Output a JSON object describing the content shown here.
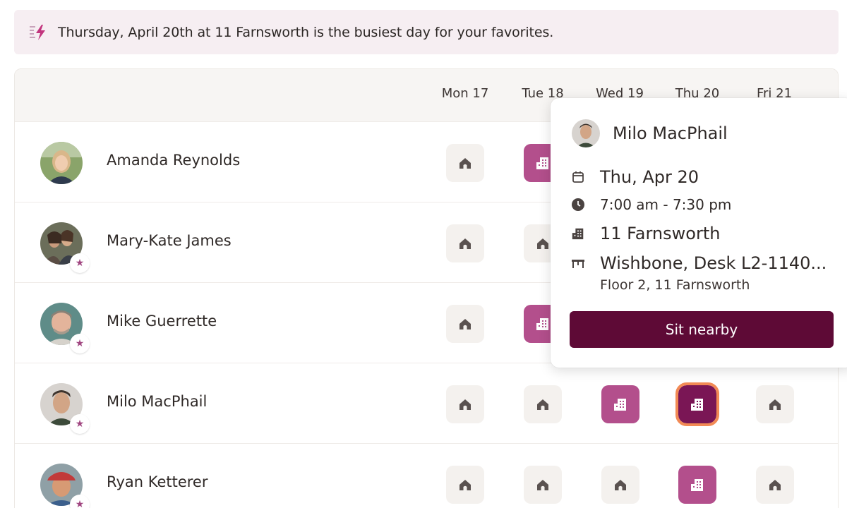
{
  "banner": {
    "icon": "bolt-icon",
    "text": "Thursday, April 20th at 11 Farnsworth is the busiest day for your favorites."
  },
  "days": [
    "Mon 17",
    "Tue 18",
    "Wed 19",
    "Thu 20",
    "Fri 21"
  ],
  "rows": [
    {
      "name": "Amanda Reynolds",
      "favorite": false,
      "cells": [
        "home",
        "office",
        "",
        "",
        ""
      ]
    },
    {
      "name": "Mary-Kate James",
      "favorite": true,
      "cells": [
        "home",
        "home",
        "",
        "",
        ""
      ]
    },
    {
      "name": "Mike Guerrette",
      "favorite": true,
      "cells": [
        "home",
        "office",
        "",
        "",
        ""
      ]
    },
    {
      "name": "Milo MacPhail",
      "favorite": true,
      "cells": [
        "home",
        "home",
        "office",
        "office-selected",
        "home"
      ]
    },
    {
      "name": "Ryan Ketterer",
      "favorite": true,
      "cells": [
        "home",
        "home",
        "home",
        "office",
        "home"
      ]
    }
  ],
  "popover": {
    "name": "Milo MacPhail",
    "date": "Thu, Apr 20",
    "time": "7:00 am - 7:30 pm",
    "building": "11 Farnsworth",
    "desk": "Wishbone, Desk L2-1140...",
    "floor": "Floor 2, 11 Farnsworth",
    "button_label": "Sit nearby"
  },
  "colors": {
    "banner_bg": "#f6eef2",
    "office": "#b34f8c",
    "office_selected": "#7a1655",
    "selected_outline": "#f28a55",
    "button": "#5e0a36",
    "favorite_star": "#a04580"
  }
}
